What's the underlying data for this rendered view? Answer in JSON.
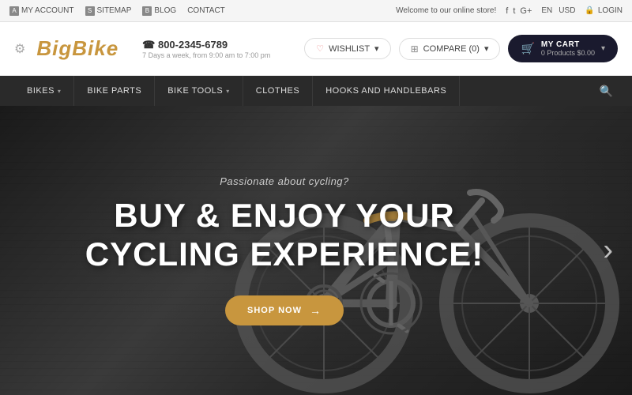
{
  "topbar": {
    "links": [
      {
        "label": "MY ACCOUNT",
        "name": "my-account"
      },
      {
        "label": "SITEMAP",
        "name": "sitemap"
      },
      {
        "label": "BLOG",
        "name": "blog"
      },
      {
        "label": "CONTACT",
        "name": "contact"
      }
    ],
    "welcome": "Welcome to our online store!",
    "social": [
      "f",
      "t",
      "G+"
    ],
    "lang": "EN",
    "currency": "USD",
    "login": "LOGIN"
  },
  "header": {
    "logo": {
      "prefix": "Big",
      "suffix": "Bike"
    },
    "phone": "☎ 800-2345-6789",
    "phone_hours": "7 Days a week, from 9:00 am to 7:00 pm",
    "wishlist_label": "WISHLIST",
    "compare_label": "COMPARE (0)",
    "cart_label": "MY CART",
    "cart_sub": "0 Products    $0.00"
  },
  "nav": {
    "items": [
      {
        "label": "BIKES",
        "has_dropdown": true
      },
      {
        "label": "BIKE PARTS",
        "has_dropdown": false
      },
      {
        "label": "BIKE TOOLS",
        "has_dropdown": true
      },
      {
        "label": "CLOTHES",
        "has_dropdown": false
      },
      {
        "label": "HOOKS AND HANDLEBARS",
        "has_dropdown": false
      }
    ]
  },
  "hero": {
    "subtitle": "Passionate about cycling?",
    "title_line1": "BUY & ENJOY YOUR",
    "title_line2": "CYCLING EXPERIENCE!",
    "shop_btn": "SHOP NOW",
    "arrow_right": "›"
  }
}
